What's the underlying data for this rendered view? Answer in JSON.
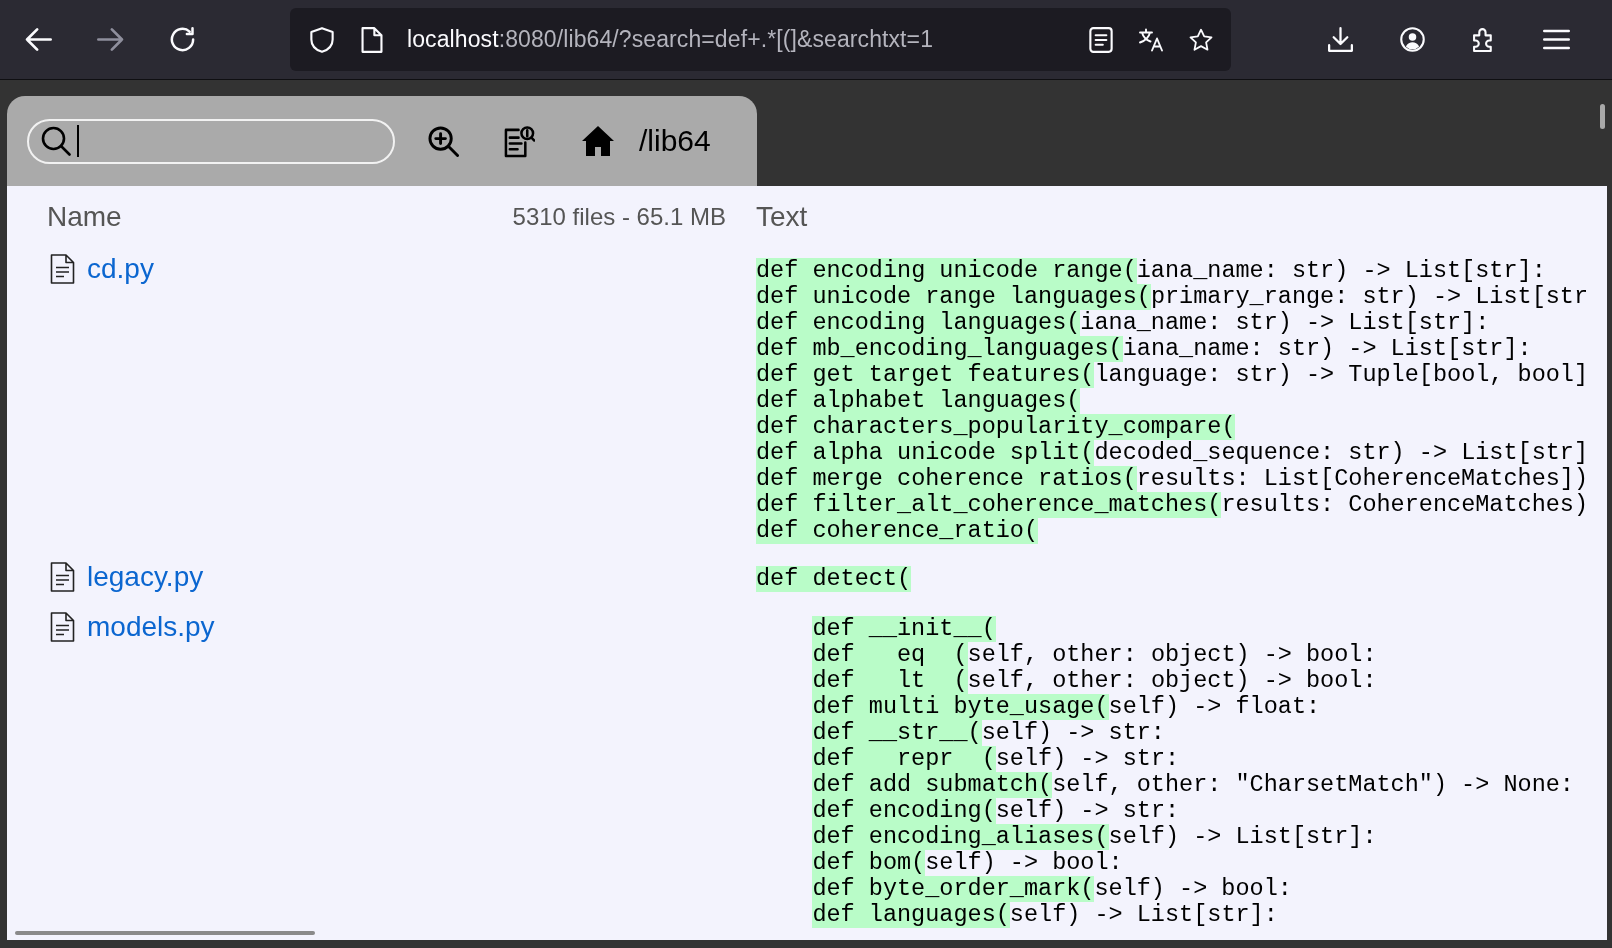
{
  "browser": {
    "nav_buttons": [
      {
        "kind": "back",
        "disabled": false
      },
      {
        "kind": "forward",
        "disabled": true
      },
      {
        "kind": "reload",
        "disabled": false
      }
    ],
    "url": {
      "host": "localhost",
      "rest": ":8080/lib64/?search=def+.*[(]&searchtxt=1"
    }
  },
  "toolbar": {
    "search": {
      "focused": true
    },
    "path": "/lib64"
  },
  "listing": {
    "columns": {
      "name": "Name",
      "summary": "5310 files - 65.1 MB",
      "text": "Text"
    },
    "rows": [
      {
        "name": "cd.py",
        "indented": false,
        "lines": [
          {
            "match": "def encoding unicode range(",
            "rest": "iana_name: str) -> List[str]:"
          },
          {
            "match": "def unicode range languages(",
            "rest": "primary_range: str) -> List[str"
          },
          {
            "match": "def encoding languages(",
            "rest": "iana_name: str) -> List[str]:"
          },
          {
            "match": "def mb_encoding_languages(",
            "rest": "iana_name: str) -> List[str]:"
          },
          {
            "match": "def get target features(",
            "rest": "language: str) -> Tuple[bool, bool]"
          },
          {
            "match": "def alphabet languages("
          },
          {
            "match": "def characters_popularity_compare("
          },
          {
            "match": "def alpha unicode split(",
            "rest": "decoded_sequence: str) -> List[str]"
          },
          {
            "match": "def merge coherence ratios(",
            "rest": "results: List[CoherenceMatches])"
          },
          {
            "match": "def filter_alt_coherence_matches(",
            "rest": "results: CoherenceMatches)"
          },
          {
            "match": "def coherence_ratio("
          }
        ]
      },
      {
        "name": "legacy.py",
        "indented": false,
        "lines": [
          {
            "match": "def detect("
          }
        ]
      },
      {
        "name": "models.py",
        "indented": true,
        "lines": [
          {
            "match": "def __init__("
          },
          {
            "match": "def   eq  (",
            "rest": "self, other: object) -> bool:"
          },
          {
            "match": "def   lt  (",
            "rest": "self, other: object) -> bool:"
          },
          {
            "match": "def multi byte_usage(",
            "rest": "self) -> float:"
          },
          {
            "match": "def __str__(",
            "rest": "self) -> str:"
          },
          {
            "match": "def   repr  (",
            "rest": "self) -> str:"
          },
          {
            "match": "def add submatch(",
            "rest": "self, other: \"CharsetMatch\") -> None:"
          },
          {
            "match": "def encoding(",
            "rest": "self) -> str:"
          },
          {
            "match": "def encoding_aliases(",
            "rest": "self) -> List[str]:"
          },
          {
            "match": "def bom(",
            "rest": "self) -> bool:"
          },
          {
            "match": "def byte_order_mark(",
            "rest": "self) -> bool:"
          },
          {
            "match": "def languages(",
            "rest": "self) -> List[str]:"
          }
        ]
      }
    ]
  }
}
